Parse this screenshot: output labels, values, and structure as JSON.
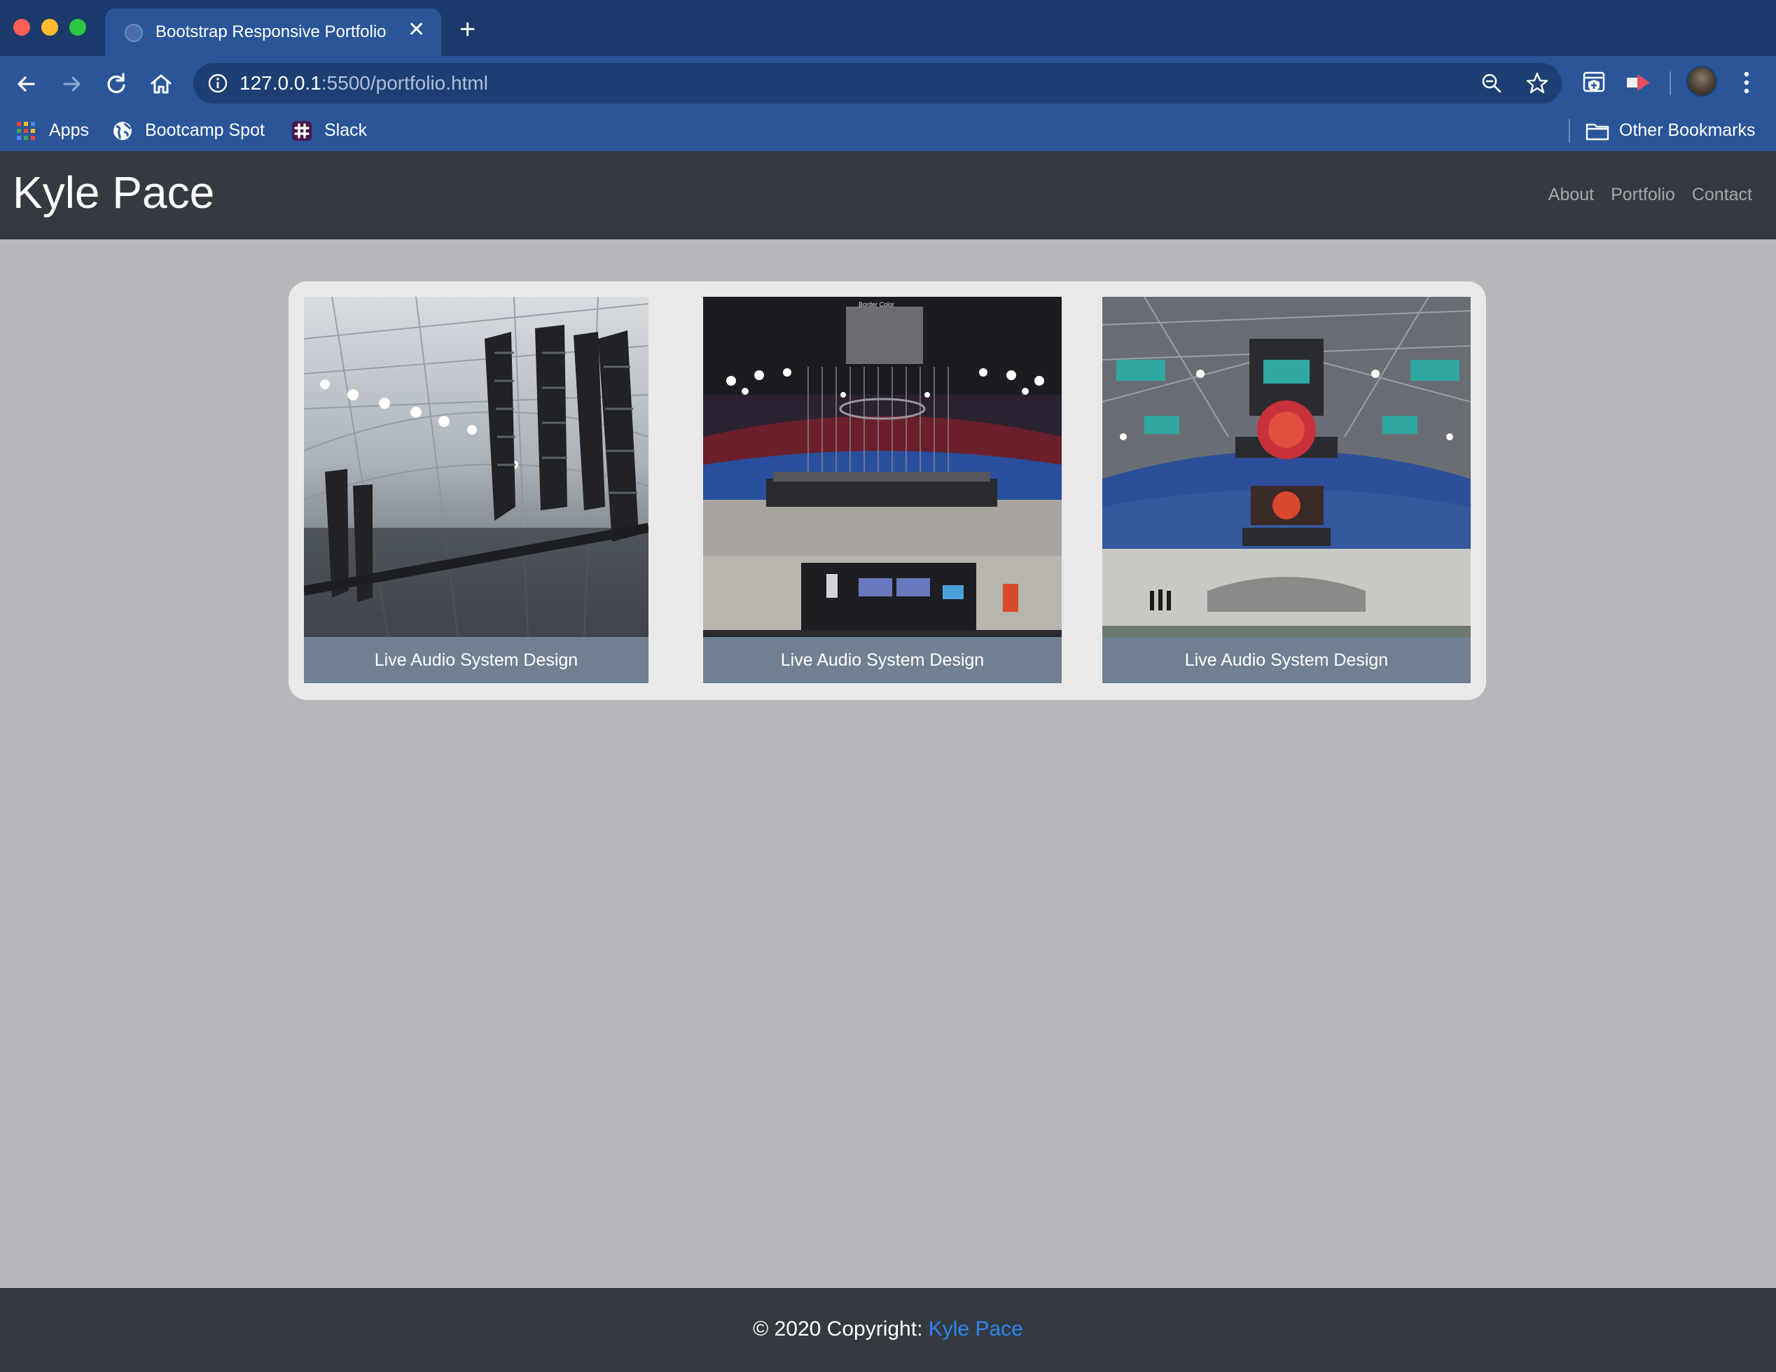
{
  "browser": {
    "tab_title": "Bootstrap Responsive Portfolio",
    "tab_close": "✕",
    "new_tab": "+",
    "url_host": "127.0.0.1",
    "url_rest": ":5500/portfolio.html",
    "bookmarks": [
      {
        "label": "Apps",
        "icon": "apps-grid-icon"
      },
      {
        "label": "Bootcamp Spot",
        "icon": "globe-icon"
      },
      {
        "label": "Slack",
        "icon": "slack-icon"
      }
    ],
    "other_bookmarks": "Other Bookmarks"
  },
  "site": {
    "brand": "Kyle Pace",
    "nav": [
      "About",
      "Portfolio",
      "Contact"
    ]
  },
  "portfolio": {
    "cards": [
      {
        "caption": "Live Audio System Design",
        "image": "line-array-speakers-in-stadium"
      },
      {
        "caption": "Live Audio System Design",
        "image": "arena-floor-with-mixing-console"
      },
      {
        "caption": "Live Audio System Design",
        "image": "arena-with-center-hung-screens"
      }
    ],
    "image_text": "Border Color"
  },
  "footer": {
    "prefix": "© 2020 Copyright:",
    "link": "Kyle Pace"
  },
  "colors": {
    "titlebar": "#1b3a6b",
    "toolbar": "#2a5599",
    "header": "#343a40",
    "page_bg": "#b6b7ba",
    "gallery_bg": "#e9e9e9",
    "caption_bg": "#708090",
    "footer_link": "#2e86f0"
  }
}
